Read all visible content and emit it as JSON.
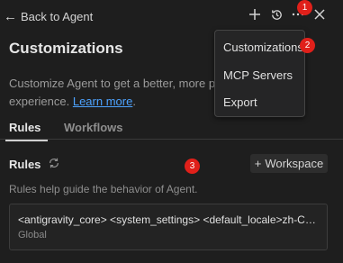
{
  "topbar": {
    "back_label": "Back to Agent",
    "icons": [
      "plus-icon",
      "history-icon",
      "more-icon",
      "close-icon"
    ]
  },
  "page": {
    "title": "Customizations",
    "description": "Customize Agent to get a better, more p",
    "description_line2": "experience.",
    "learn_more": "Learn more",
    "after_link": "."
  },
  "tabs": [
    {
      "label": "Rules",
      "active": true
    },
    {
      "label": "Workflows",
      "active": false
    }
  ],
  "rules": {
    "heading": "Rules",
    "workspace_button": "Workspace",
    "help_text": "Rules help guide the behavior of Agent.",
    "items": [
      {
        "text": "<antigravity_core> <system_settings> <default_locale>zh-CN</default_locale>",
        "scope": "Global"
      }
    ]
  },
  "menu": {
    "items": [
      "Customizations",
      "MCP Servers",
      "Export"
    ]
  },
  "annotations": [
    "1",
    "2",
    "3"
  ],
  "colors": {
    "background": "#1e1e1e",
    "link": "#4da3ff",
    "badge": "#e0201a"
  }
}
